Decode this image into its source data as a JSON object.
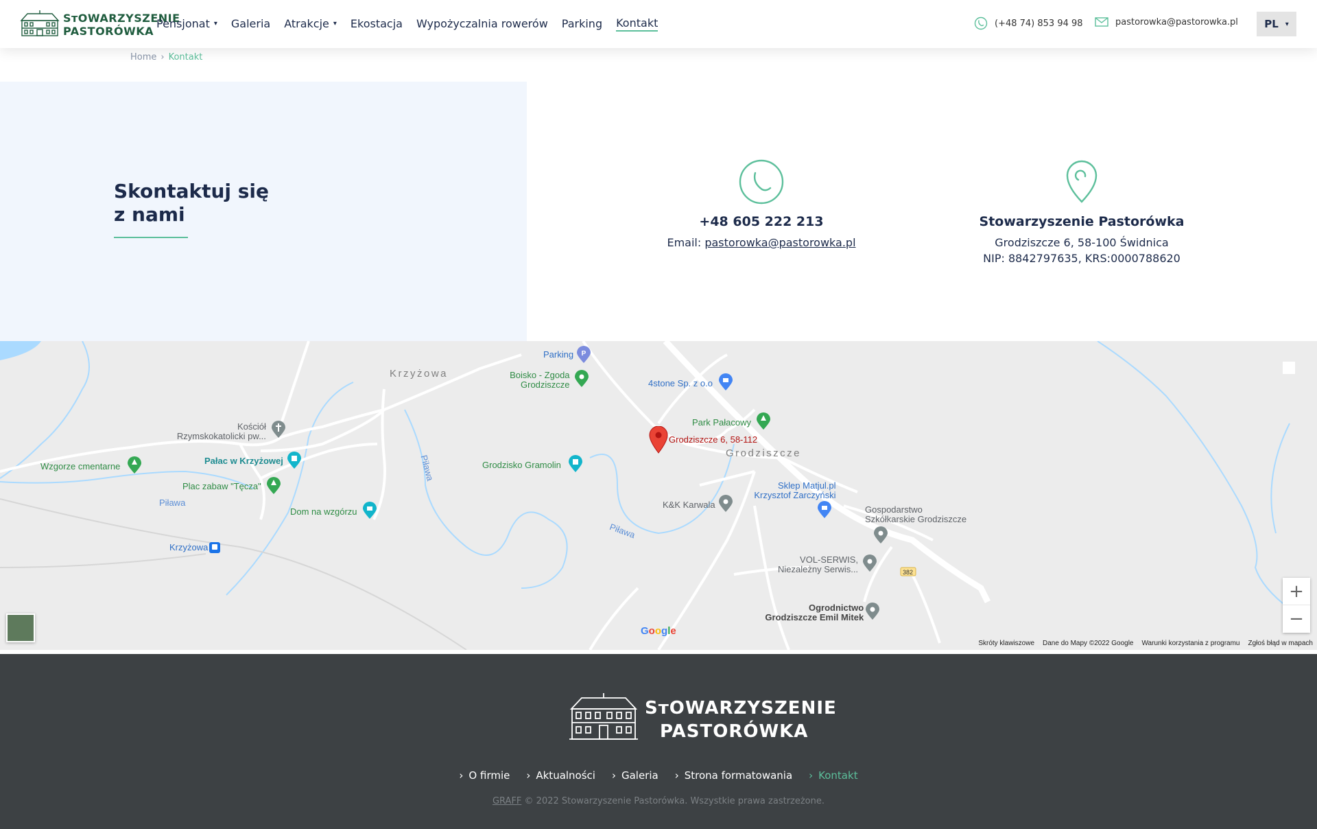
{
  "header": {
    "logo_line1": "SᴛOWARZYSZENIE",
    "logo_line2": "PASTORÓWKA",
    "nav": [
      {
        "label": "Pensjonat",
        "dropdown": true
      },
      {
        "label": "Galeria",
        "dropdown": false
      },
      {
        "label": "Atrakcje",
        "dropdown": true
      },
      {
        "label": "Ekostacja",
        "dropdown": false
      },
      {
        "label": "Wypożyczalnia rowerów",
        "dropdown": false
      },
      {
        "label": "Parking",
        "dropdown": false
      },
      {
        "label": "Kontakt",
        "dropdown": false,
        "active": true
      }
    ],
    "phone": "(+48 74) 853 94 98",
    "email": "pastorowka@pastorowka.pl",
    "language": "PL"
  },
  "breadcrumb": {
    "home": "Home",
    "separator": "›",
    "current": "Kontakt"
  },
  "contact": {
    "title_line1": "Skontaktuj się",
    "title_line2": "z nami",
    "phone_card": {
      "title": "+48 605 222 213",
      "email_label": "Email:",
      "email": "pastorowka@pastorowka.pl"
    },
    "address_card": {
      "title": "Stowarzyszenie Pastorówka",
      "address": "Grodziszcze 6, 58-100 Świdnica",
      "ids": "NIP: 8842797635, KRS:0000788620"
    }
  },
  "map": {
    "towns": [
      "Krzyżowa",
      "Grodziszcze"
    ],
    "places": {
      "parking": "Parking",
      "boisko1": "Boisko - Zgoda",
      "boisko2": "Grodziszcze",
      "fourstone": "4stone Sp. z o.o",
      "park": "Park Pałacowy",
      "marker": "Grodziszcze 6, 58-112",
      "kosciol1": "Kościół",
      "kosciol2": "Rzymskokatolicki pw...",
      "wzgorze": "Wzgorze cmentarne",
      "palac": "Pałac w Krzyżowej",
      "plac": "Plac zabaw \"Tęcza\"",
      "dom": "Dom na wzgórzu",
      "gramolin": "Grodzisko Gramolin",
      "kk": "K&K Karwala",
      "sklep1": "Sklep Matjul.pl",
      "sklep2": "Krzysztof Zarczyński",
      "gosp1": "Gospodarstwo",
      "gosp2": "Szkółkarskie Grodziszcze",
      "vol1": "VOL-SERWIS,",
      "vol2": "Niezależny Serwis...",
      "ogr1": "Ogrodnictwo",
      "ogr2": "Grodziszcze Emil Mitek",
      "krzyzowa_stop": "Krzyżowa",
      "pilawa1": "Piława",
      "pilawa2": "Piława",
      "pilawa3": "Piława",
      "road": "382"
    },
    "footer_links": [
      "Skróty klawiszowe",
      "Dane do Mapy ©2022 Google",
      "Warunki korzystania z programu",
      "Zgłoś błąd w mapach"
    ],
    "google": "Google"
  },
  "footer": {
    "logo_line1": "SᴛOWARZYSZENIE",
    "logo_line2": "PASTORÓWKA",
    "nav": [
      "O firmie",
      "Aktualności",
      "Galeria",
      "Strona formatowania",
      "Kontakt"
    ],
    "copyright_link": "GRAFF",
    "copyright_text": "© 2022 Stowarzyszenie Pastorówka. Wszystkie prawa zastrzeżone."
  },
  "colors": {
    "accent": "#5cbf9b",
    "navy": "#1c2a4a",
    "footer_bg": "#3d4144",
    "panel_bg": "#f1f6fd"
  }
}
